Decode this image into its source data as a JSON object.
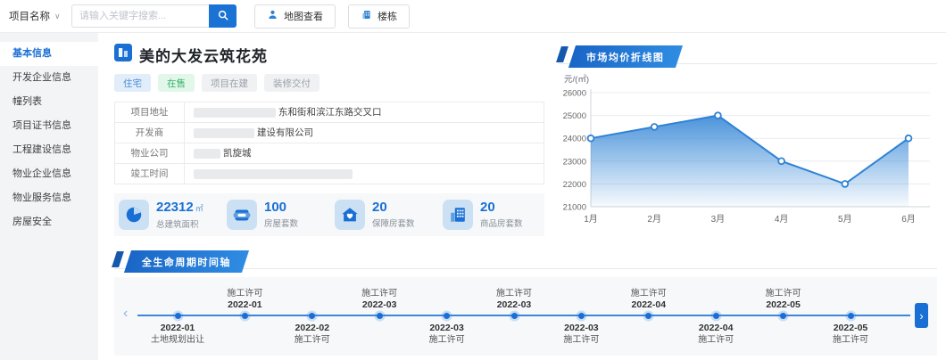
{
  "topbar": {
    "project_select": {
      "label": "项目名称",
      "chevron": "∨"
    },
    "search": {
      "placeholder": "请输入关键字搜索..."
    },
    "map_button": "地图查看",
    "building_button": "楼栋"
  },
  "sidebar": {
    "items": [
      {
        "label": "基本信息",
        "active": true
      },
      {
        "label": "开发企业信息",
        "active": false
      },
      {
        "label": "幢列表",
        "active": false
      },
      {
        "label": "项目证书信息",
        "active": false
      },
      {
        "label": "工程建设信息",
        "active": false
      },
      {
        "label": "物业企业信息",
        "active": false
      },
      {
        "label": "物业服务信息",
        "active": false
      },
      {
        "label": "房屋安全",
        "active": false
      }
    ]
  },
  "project": {
    "title": "美的大发云筑花苑",
    "tags": [
      {
        "label": "住宅",
        "type": "blue"
      },
      {
        "label": "在售",
        "type": "green"
      },
      {
        "label": "项目在建",
        "type": "gray"
      },
      {
        "label": "装修交付",
        "type": "gray"
      }
    ],
    "info_rows": [
      {
        "label": "项目地址",
        "value": "东和街和滨江东路交叉口",
        "redact_width": 92
      },
      {
        "label": "开发商",
        "value": "建设有限公司",
        "redact_width": 68
      },
      {
        "label": "物业公司",
        "value": "凯旋城",
        "redact_width": 30
      },
      {
        "label": "竣工时间",
        "value": "",
        "redact_width": 178
      }
    ],
    "stats": [
      {
        "icon": "pie-chart-icon",
        "value": "22312",
        "unit": "㎡",
        "label": "总建筑面积"
      },
      {
        "icon": "card-icon",
        "value": "100",
        "unit": "",
        "label": "房屋套数"
      },
      {
        "icon": "house-heart-icon",
        "value": "20",
        "unit": "",
        "label": "保障房套数"
      },
      {
        "icon": "building-grid-icon",
        "value": "20",
        "unit": "",
        "label": "商品房套数"
      }
    ]
  },
  "chart_section": {
    "title": "市场均价折线图"
  },
  "chart_data": {
    "type": "area",
    "title": "市场均价折线图",
    "ylabel": "元/(㎡)",
    "categories": [
      "1月",
      "2月",
      "3月",
      "4月",
      "5月",
      "6月"
    ],
    "values": [
      24000,
      24500,
      25000,
      23000,
      22000,
      24000
    ],
    "ylim": [
      21000,
      26000
    ],
    "ytick_step": 1000,
    "grid": true,
    "legend": false
  },
  "timeline_section": {
    "title": "全生命周期时间轴",
    "prev_glyph": "‹",
    "next_glyph": "›",
    "items": [
      {
        "date": "2022-01",
        "event": "土地规划出让",
        "position": "below"
      },
      {
        "date": "2022-01",
        "event": "施工许可",
        "position": "above"
      },
      {
        "date": "2022-02",
        "event": "施工许可",
        "position": "below"
      },
      {
        "date": "2022-03",
        "event": "施工许可",
        "position": "above"
      },
      {
        "date": "2022-03",
        "event": "施工许可",
        "position": "below"
      },
      {
        "date": "2022-03",
        "event": "施工许可",
        "position": "above"
      },
      {
        "date": "2022-03",
        "event": "施工许可",
        "position": "below"
      },
      {
        "date": "2022-04",
        "event": "施工许可",
        "position": "above"
      },
      {
        "date": "2022-04",
        "event": "施工许可",
        "position": "below"
      },
      {
        "date": "2022-05",
        "event": "施工许可",
        "position": "above"
      },
      {
        "date": "2022-05",
        "event": "施工许可",
        "position": "below"
      }
    ]
  },
  "colors": {
    "accent": "#1a6fd4",
    "search_button": "#1a73d4",
    "banner_gradient_start": "#1a66c7",
    "banner_gradient_end": "#2f8ce2",
    "chart_line": "#2e82d5",
    "tag_blue_text": "#4a8fd8",
    "tag_green_text": "#33b567",
    "stat_icon_bg": "#cce0f4",
    "band_bg": "#f6f8fa",
    "sidebar_bg": "#f3f4f6"
  }
}
